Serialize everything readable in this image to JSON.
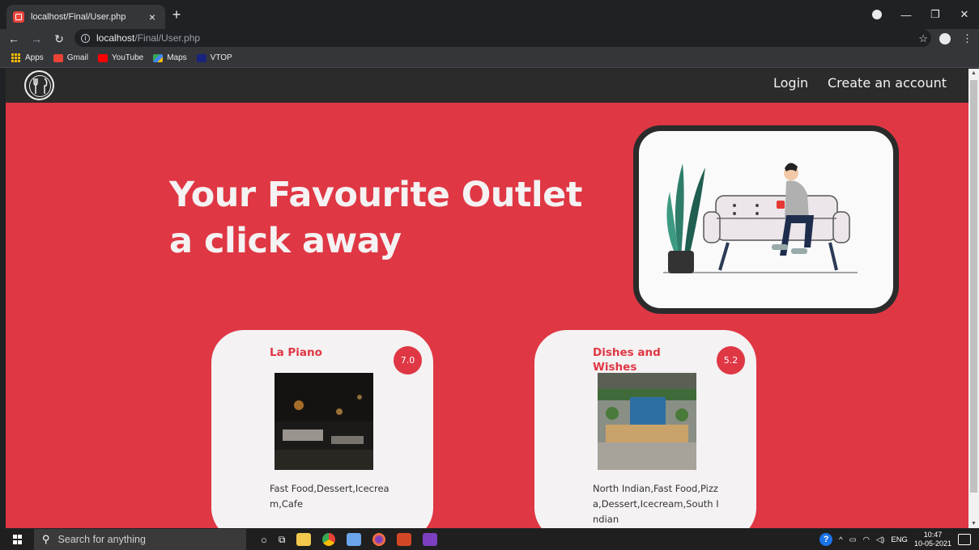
{
  "browser": {
    "tab_title": "localhost/Final/User.php",
    "tab_close": "×",
    "new_tab": "+",
    "url_host": "localhost",
    "url_path": "/Final/User.php",
    "bookmarks": [
      "Apps",
      "Gmail",
      "YouTube",
      "Maps",
      "VTOP"
    ]
  },
  "site": {
    "nav": {
      "login": "Login",
      "create_account": "Create an account"
    },
    "hero": {
      "line1": "Your Favourite Outlet",
      "line2": "a click away"
    },
    "restaurants": [
      {
        "name": "La Piano",
        "rating": "7.0",
        "cuisines": "Fast Food,Dessert,Icecream,Cafe"
      },
      {
        "name": "Dishes and Wishes",
        "rating": "5.2",
        "cuisines": "North Indian,Fast Food,Pizza,Dessert,Icecream,South Indian"
      }
    ],
    "accent_color": "#df3744",
    "nav_color": "#2b2b2b"
  },
  "taskbar": {
    "search_placeholder": "Search for anything",
    "language": "ENG",
    "time": "10:47",
    "date": "10-05-2021"
  }
}
